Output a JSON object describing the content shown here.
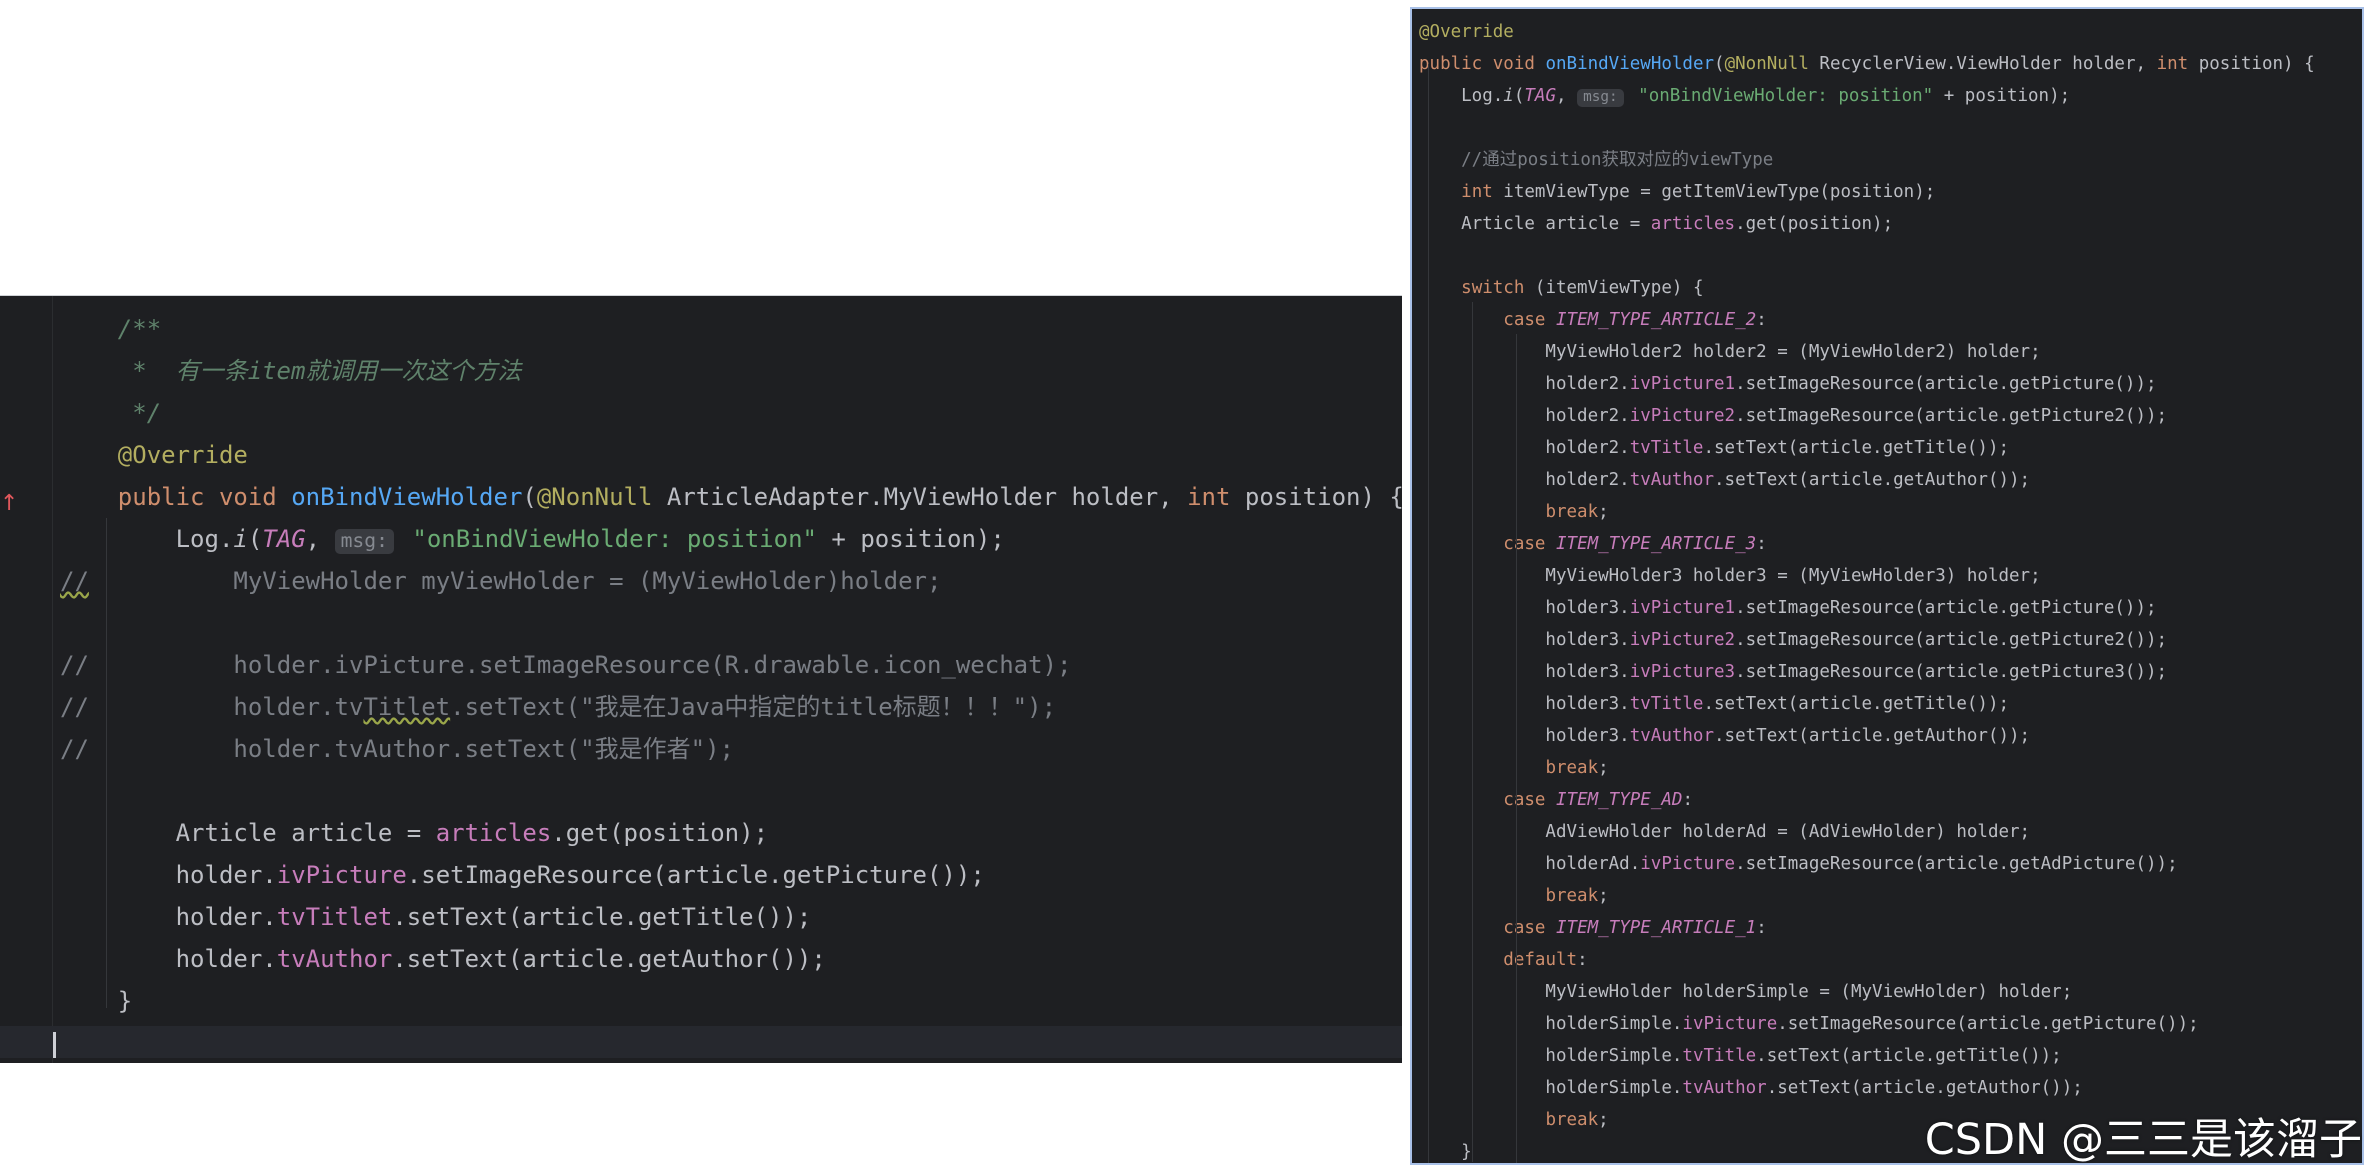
{
  "left_panel": {
    "lines": [
      "    /**",
      "     *  有一条item就调用一次这个方法",
      "     */",
      "    @Override",
      "    public void onBindViewHolder(@NonNull ArticleAdapter.MyViewHolder holder, int position) {",
      "        Log.i(TAG, msg: \"onBindViewHolder: position\" + position);",
      "//          MyViewHolder myViewHolder = (MyViewHolder)holder;",
      "",
      "//          holder.ivPicture.setImageResource(R.drawable.icon_wechat);",
      "//          holder.tvTitlet.setText(\"我是在Java中指定的title标题！！！\");",
      "//          holder.tvAuthor.setText(\"我是作者\");",
      "",
      "        Article article = articles.get(position);",
      "        holder.ivPicture.setImageResource(article.getPicture());",
      "        holder.tvTitlet.setText(article.getTitle());",
      "        holder.tvAuthor.setText(article.getAuthor());",
      "    }",
      ""
    ],
    "override_marker": "↑"
  },
  "right_panel": {
    "lines": [
      "@Override",
      "public void onBindViewHolder(@NonNull RecyclerView.ViewHolder holder, int position) {",
      "    Log.i(TAG, msg: \"onBindViewHolder: position\" + position);",
      "",
      "    //通过position获取对应的viewType",
      "    int itemViewType = getItemViewType(position);",
      "    Article article = articles.get(position);",
      "",
      "    switch (itemViewType) {",
      "        case ITEM_TYPE_ARTICLE_2:",
      "            MyViewHolder2 holder2 = (MyViewHolder2) holder;",
      "            holder2.ivPicture1.setImageResource(article.getPicture());",
      "            holder2.ivPicture2.setImageResource(article.getPicture2());",
      "            holder2.tvTitle.setText(article.getTitle());",
      "            holder2.tvAuthor.setText(article.getAuthor());",
      "            break;",
      "        case ITEM_TYPE_ARTICLE_3:",
      "            MyViewHolder3 holder3 = (MyViewHolder3) holder;",
      "            holder3.ivPicture1.setImageResource(article.getPicture());",
      "            holder3.ivPicture2.setImageResource(article.getPicture2());",
      "            holder3.ivPicture3.setImageResource(article.getPicture3());",
      "            holder3.tvTitle.setText(article.getTitle());",
      "            holder3.tvAuthor.setText(article.getAuthor());",
      "            break;",
      "        case ITEM_TYPE_AD:",
      "            AdViewHolder holderAd = (AdViewHolder) holder;",
      "            holderAd.ivPicture.setImageResource(article.getAdPicture());",
      "            break;",
      "        case ITEM_TYPE_ARTICLE_1:",
      "        default:",
      "            MyViewHolder holderSimple = (MyViewHolder) holder;",
      "            holderSimple.ivPicture.setImageResource(article.getPicture());",
      "            holderSimple.tvTitle.setText(article.getTitle());",
      "            holderSimple.tvAuthor.setText(article.getAuthor());",
      "            break;",
      "    }"
    ]
  },
  "watermark": "CSDN @三三是该溜子",
  "colors": {
    "editor_bg": "#1e1f22",
    "keyword": "#cf8e6d",
    "function": "#56a8f5",
    "annotation": "#b3ae60",
    "string": "#6aab73",
    "field": "#c77dbb",
    "comment": "#7a7e85",
    "doc_comment": "#5f826b",
    "default_text": "#bcbec4"
  }
}
